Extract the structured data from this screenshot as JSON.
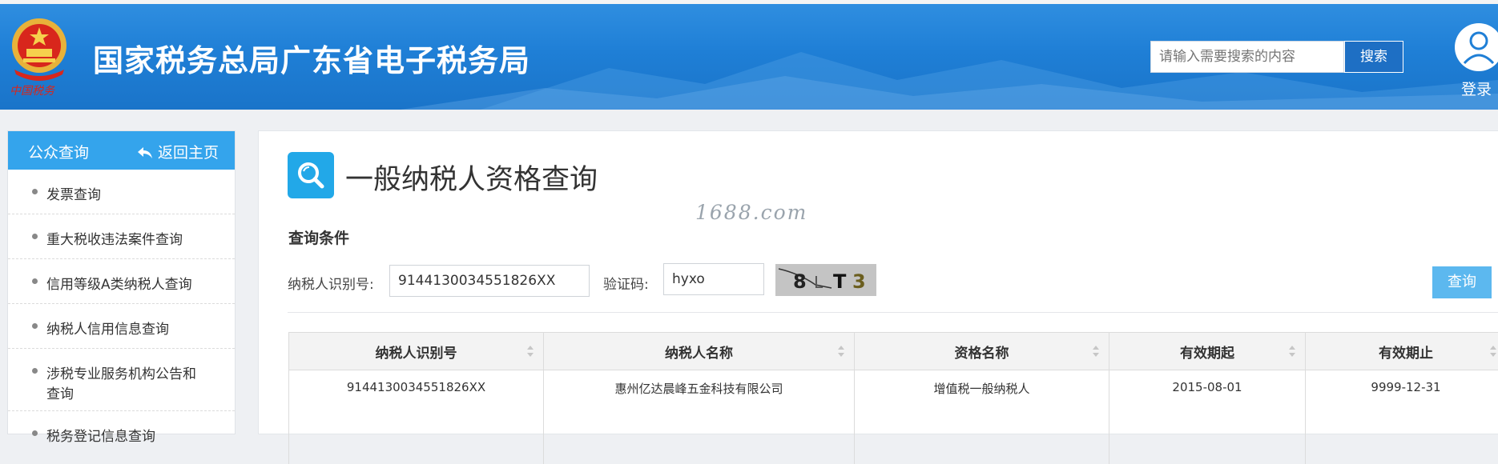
{
  "header": {
    "site_title": "国家税务总局广东省电子税务局",
    "emblem_caption": "中国税务",
    "search_placeholder": "请输入需要搜索的内容",
    "search_button": "搜索",
    "login_label": "登录"
  },
  "sidebar": {
    "title": "公众查询",
    "back_label": "返回主页",
    "items": [
      {
        "label": "发票查询"
      },
      {
        "label": "重大税收违法案件查询"
      },
      {
        "label": "信用等级A类纳税人查询"
      },
      {
        "label": "纳税人信用信息查询"
      },
      {
        "label_line1": "涉税专业服务机构公告和",
        "label_line2": "查询"
      },
      {
        "label": "税务登记信息查询"
      }
    ]
  },
  "main": {
    "page_title": "一般纳税人资格查询",
    "watermark": "1688.com",
    "section_label": "查询条件",
    "taxpayer_id_label": "纳税人识别号:",
    "taxpayer_id_value": "9144130034551826XX",
    "captcha_label": "验证码:",
    "captcha_value": "hyxo",
    "captcha_chars": [
      "8",
      "L",
      "T",
      "3"
    ],
    "query_button": "查询"
  },
  "table": {
    "headers": [
      "纳税人识别号",
      "纳税人名称",
      "资格名称",
      "有效期起",
      "有效期止"
    ],
    "rows": [
      [
        "9144130034551826XX",
        "惠州亿达晨峰五金科技有限公司",
        "增值税一般纳税人",
        "2015-08-01",
        "9999-12-31"
      ]
    ]
  },
  "colors": {
    "header_blue": "#1f7fd6",
    "sidebar_head": "#34a4ec",
    "title_icon": "#22a8e8",
    "query_button": "#5cb8ef",
    "search_button": "#1e6fc4"
  }
}
